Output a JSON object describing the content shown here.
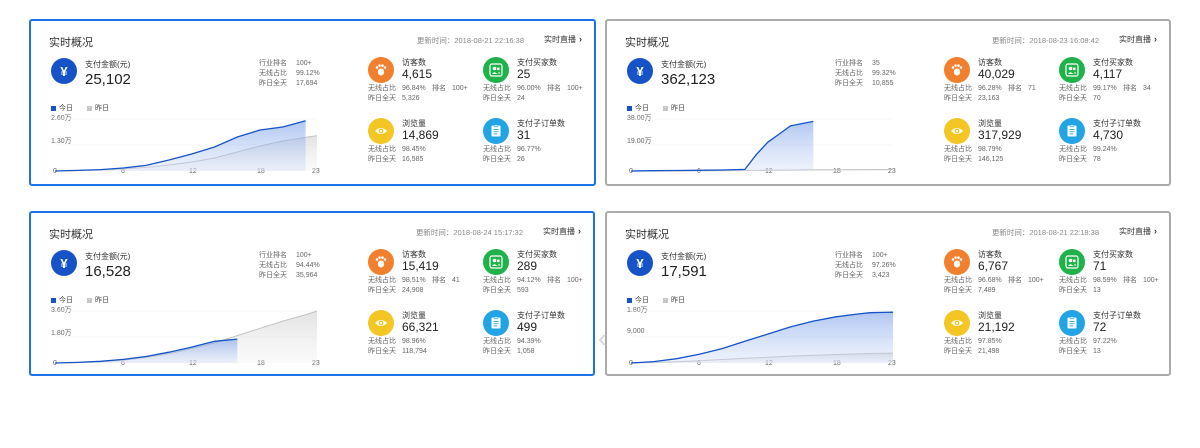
{
  "cards": [
    {
      "title": "实时概况",
      "update": "更新时间：2018-08-21 22:16:38",
      "live": "实时直播",
      "pay_label": "支付金额(元)",
      "pay_value": "25,102",
      "rank": [
        [
          "行业排名",
          "100+"
        ],
        [
          "无线占比",
          "99.12%"
        ],
        [
          "昨日全天",
          "17,694"
        ]
      ],
      "legend_today": "今日",
      "legend_yesterday": "昨日",
      "ylabels": [
        "2.60万",
        "1.30万"
      ],
      "xlabels": [
        "0",
        "6",
        "12",
        "18",
        "23"
      ],
      "metrics": [
        {
          "label": "访客数",
          "value": "4,615",
          "ratio_k": "无线占比",
          "ratio_v": "96.84%",
          "rank_k": "排名",
          "rank_v": "100+",
          "yday_k": "昨日全天",
          "yday_v": "5,326"
        },
        {
          "label": "支付买家数",
          "value": "25",
          "ratio_k": "无线占比",
          "ratio_v": "96.00%",
          "rank_k": "排名",
          "rank_v": "100+",
          "yday_k": "昨日全天",
          "yday_v": "24"
        },
        {
          "label": "浏览量",
          "value": "14,869",
          "ratio_k": "无线占比",
          "ratio_v": "98.45%",
          "rank_k": "",
          "rank_v": "",
          "yday_k": "昨日全天",
          "yday_v": "16,585"
        },
        {
          "label": "支付子订单数",
          "value": "31",
          "ratio_k": "无线占比",
          "ratio_v": "96.77%",
          "rank_k": "",
          "rank_v": "",
          "yday_k": "昨日全天",
          "yday_v": "26"
        }
      ]
    },
    {
      "title": "实时概况",
      "update": "更新时间：2018-08-23 16:08:42",
      "live": "实时直播",
      "pay_label": "支付金额(元)",
      "pay_value": "362,123",
      "rank": [
        [
          "行业排名",
          "35"
        ],
        [
          "无线占比",
          "99.32%"
        ],
        [
          "昨日全天",
          "10,855"
        ]
      ],
      "legend_today": "今日",
      "legend_yesterday": "昨日",
      "ylabels": [
        "38.00万",
        "19.00万"
      ],
      "xlabels": [
        "0",
        "6",
        "12",
        "18",
        "23"
      ],
      "metrics": [
        {
          "label": "访客数",
          "value": "40,029",
          "ratio_k": "无线占比",
          "ratio_v": "96.28%",
          "rank_k": "排名",
          "rank_v": "71",
          "yday_k": "昨日全天",
          "yday_v": "23,163"
        },
        {
          "label": "支付买家数",
          "value": "4,117",
          "ratio_k": "无线占比",
          "ratio_v": "99.17%",
          "rank_k": "排名",
          "rank_v": "34",
          "yday_k": "昨日全天",
          "yday_v": "70"
        },
        {
          "label": "浏览量",
          "value": "317,929",
          "ratio_k": "无线占比",
          "ratio_v": "98.79%",
          "rank_k": "",
          "rank_v": "",
          "yday_k": "昨日全天",
          "yday_v": "146,125"
        },
        {
          "label": "支付子订单数",
          "value": "4,730",
          "ratio_k": "无线占比",
          "ratio_v": "99.24%",
          "rank_k": "",
          "rank_v": "",
          "yday_k": "昨日全天",
          "yday_v": "78"
        }
      ]
    },
    {
      "title": "实时概况",
      "update": "更新时间：2018-08-24 15:17:32",
      "live": "实时直播",
      "pay_label": "支付金额(元)",
      "pay_value": "16,528",
      "rank": [
        [
          "行业排名",
          "100+"
        ],
        [
          "无线占比",
          "94.44%"
        ],
        [
          "昨日全天",
          "35,964"
        ]
      ],
      "legend_today": "今日",
      "legend_yesterday": "昨日",
      "ylabels": [
        "3.60万",
        "1.80万"
      ],
      "xlabels": [
        "0",
        "6",
        "12",
        "18",
        "23"
      ],
      "metrics": [
        {
          "label": "访客数",
          "value": "15,419",
          "ratio_k": "无线占比",
          "ratio_v": "98.51%",
          "rank_k": "排名",
          "rank_v": "41",
          "yday_k": "昨日全天",
          "yday_v": "24,908"
        },
        {
          "label": "支付买家数",
          "value": "289",
          "ratio_k": "无线占比",
          "ratio_v": "94.12%",
          "rank_k": "排名",
          "rank_v": "100+",
          "yday_k": "昨日全天",
          "yday_v": "593"
        },
        {
          "label": "浏览量",
          "value": "66,321",
          "ratio_k": "无线占比",
          "ratio_v": "98.96%",
          "rank_k": "",
          "rank_v": "",
          "yday_k": "昨日全天",
          "yday_v": "118,794"
        },
        {
          "label": "支付子订单数",
          "value": "499",
          "ratio_k": "无线占比",
          "ratio_v": "94.39%",
          "rank_k": "",
          "rank_v": "",
          "yday_k": "昨日全天",
          "yday_v": "1,058"
        }
      ]
    },
    {
      "title": "实时概况",
      "update": "更新时间：2018-08-21 22:18:38",
      "live": "实时直播",
      "pay_label": "支付金额(元)",
      "pay_value": "17,591",
      "rank": [
        [
          "行业排名",
          "100+"
        ],
        [
          "无线占比",
          "97.26%"
        ],
        [
          "昨日全天",
          "3,423"
        ]
      ],
      "legend_today": "今日",
      "legend_yesterday": "昨日",
      "ylabels": [
        "1.80万",
        "9,000"
      ],
      "xlabels": [
        "0",
        "6",
        "12",
        "18",
        "23"
      ],
      "metrics": [
        {
          "label": "访客数",
          "value": "6,767",
          "ratio_k": "无线占比",
          "ratio_v": "96.68%",
          "rank_k": "排名",
          "rank_v": "100+",
          "yday_k": "昨日全天",
          "yday_v": "7,489"
        },
        {
          "label": "支付买家数",
          "value": "71",
          "ratio_k": "无线占比",
          "ratio_v": "98.59%",
          "rank_k": "排名",
          "rank_v": "100+",
          "yday_k": "昨日全天",
          "yday_v": "13"
        },
        {
          "label": "浏览量",
          "value": "21,192",
          "ratio_k": "无线占比",
          "ratio_v": "97.85%",
          "rank_k": "",
          "rank_v": "",
          "yday_k": "昨日全天",
          "yday_v": "21,498"
        },
        {
          "label": "支付子订单数",
          "value": "72",
          "ratio_k": "无线占比",
          "ratio_v": "97.22%",
          "rank_k": "",
          "rank_v": "",
          "yday_k": "昨日全天",
          "yday_v": "13"
        }
      ]
    }
  ],
  "chart_data": [
    {
      "type": "area",
      "x": [
        0,
        2,
        4,
        6,
        8,
        10,
        12,
        14,
        16,
        18,
        20,
        22,
        23
      ],
      "ylim": [
        0,
        26000
      ],
      "yticks": [
        "2.60万",
        "1.30万"
      ],
      "series": [
        {
          "name": "今日",
          "values": [
            0,
            300,
            700,
            1500,
            2800,
            5500,
            8500,
            12000,
            17000,
            20500,
            22000,
            25102,
            null
          ]
        },
        {
          "name": "昨日",
          "values": [
            0,
            200,
            500,
            1000,
            1800,
            3000,
            4500,
            6500,
            9500,
            12500,
            15000,
            16800,
            17694
          ]
        }
      ]
    },
    {
      "type": "area",
      "x": [
        0,
        2,
        4,
        6,
        8,
        10,
        11,
        12,
        13,
        14,
        16,
        18,
        20,
        22,
        23
      ],
      "ylim": [
        0,
        380000
      ],
      "yticks": [
        "38.00万",
        "19.00万"
      ],
      "series": [
        {
          "name": "今日",
          "values": [
            0,
            2000,
            3500,
            5000,
            7000,
            12000,
            120000,
            210000,
            270000,
            330000,
            362123,
            null,
            null,
            null,
            null
          ]
        },
        {
          "name": "昨日",
          "values": [
            0,
            500,
            1000,
            1500,
            2500,
            3500,
            4500,
            5500,
            6500,
            7500,
            8500,
            9500,
            10200,
            10700,
            10855
          ]
        }
      ]
    },
    {
      "type": "area",
      "x": [
        0,
        2,
        4,
        6,
        8,
        10,
        12,
        14,
        16,
        18,
        20,
        22,
        23
      ],
      "ylim": [
        0,
        36000
      ],
      "yticks": [
        "3.60万",
        "1.80万"
      ],
      "series": [
        {
          "name": "今日",
          "values": [
            0,
            400,
            1200,
            2500,
            4500,
            7500,
            11000,
            15000,
            16528,
            null,
            null,
            null,
            null
          ]
        },
        {
          "name": "昨日",
          "values": [
            0,
            300,
            900,
            2000,
            3800,
            6500,
            10000,
            14000,
            19000,
            24000,
            29000,
            33500,
            35964
          ]
        }
      ]
    },
    {
      "type": "area",
      "x": [
        0,
        2,
        4,
        6,
        8,
        10,
        12,
        14,
        16,
        18,
        20,
        21,
        23
      ],
      "ylim": [
        0,
        18000
      ],
      "yticks": [
        "1.80万",
        "9,000"
      ],
      "series": [
        {
          "name": "今日",
          "values": [
            0,
            500,
            1500,
            3000,
            5000,
            7500,
            10000,
            12500,
            14500,
            16000,
            17000,
            17400,
            17591
          ]
        },
        {
          "name": "昨日",
          "values": [
            0,
            150,
            400,
            800,
            1200,
            1600,
            2000,
            2400,
            2700,
            2950,
            3150,
            3300,
            3423
          ]
        }
      ]
    }
  ]
}
